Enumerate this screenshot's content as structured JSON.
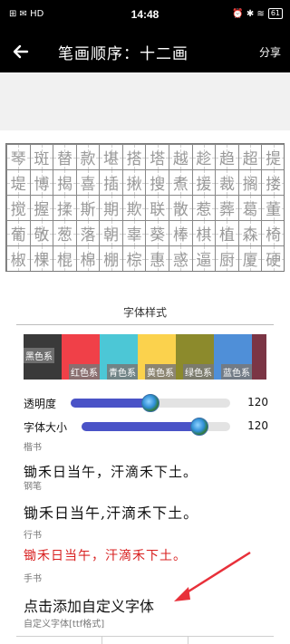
{
  "status_bar": {
    "left_icons": "⊞ ✉ HD",
    "time": "14:48",
    "right_icons": "⏰ ✱ ≋",
    "battery": "61"
  },
  "header": {
    "title": "笔画顺序：十二画",
    "share_label": "分享"
  },
  "grid": {
    "rows": [
      [
        "琴",
        "斑",
        "替",
        "款",
        "堪",
        "搭",
        "塔",
        "越",
        "趁",
        "趋",
        "超",
        "提"
      ],
      [
        "堤",
        "博",
        "揭",
        "喜",
        "插",
        "揪",
        "搜",
        "煮",
        "援",
        "裁",
        "搁",
        "搂"
      ],
      [
        "搅",
        "握",
        "揉",
        "斯",
        "期",
        "欺",
        "联",
        "散",
        "惹",
        "葬",
        "葛",
        "董"
      ],
      [
        "葡",
        "敬",
        "葱",
        "落",
        "朝",
        "辜",
        "葵",
        "棒",
        "棋",
        "植",
        "森",
        "椅"
      ],
      [
        "椒",
        "棵",
        "棍",
        "棉",
        "棚",
        "棕",
        "惠",
        "惑",
        "逼",
        "厨",
        "厦",
        "硬"
      ]
    ]
  },
  "panel": {
    "title": "字体样式",
    "swatches": [
      {
        "label": "黑色系",
        "color": "#3a3a3a"
      },
      {
        "label": "红色系",
        "color": "#f04048"
      },
      {
        "label": "青色系",
        "color": "#4cc7d6"
      },
      {
        "label": "黄色系",
        "color": "#fbd24d"
      },
      {
        "label": "绿色系",
        "color": "#8c8a2c"
      },
      {
        "label": "蓝色系",
        "color": "#4f8fd8"
      },
      {
        "label": "紫",
        "color": "#7b3545"
      }
    ],
    "opacity": {
      "label": "透明度",
      "value": "120",
      "fraction": 0.5
    },
    "font_size": {
      "label": "字体大小",
      "value": "120",
      "fraction": 0.79
    },
    "fonts": [
      {
        "name": "楷书",
        "sample": "锄禾日当午，汗滴禾下土。",
        "color": "#111111"
      },
      {
        "name": "钢笔",
        "sample": "锄禾日当午,汗滴禾下土。",
        "color": "#111111"
      },
      {
        "name": "行书",
        "sample": "锄禾日当午，汗滴禾下土。",
        "color": "#d82020"
      },
      {
        "name": "手书",
        "sample": "",
        "color": "#111111"
      }
    ],
    "add_font_label": "点击添加自定义字体",
    "add_font_sub": "自定义字体[ttf格式]",
    "arrow_color": "#e8303a"
  }
}
